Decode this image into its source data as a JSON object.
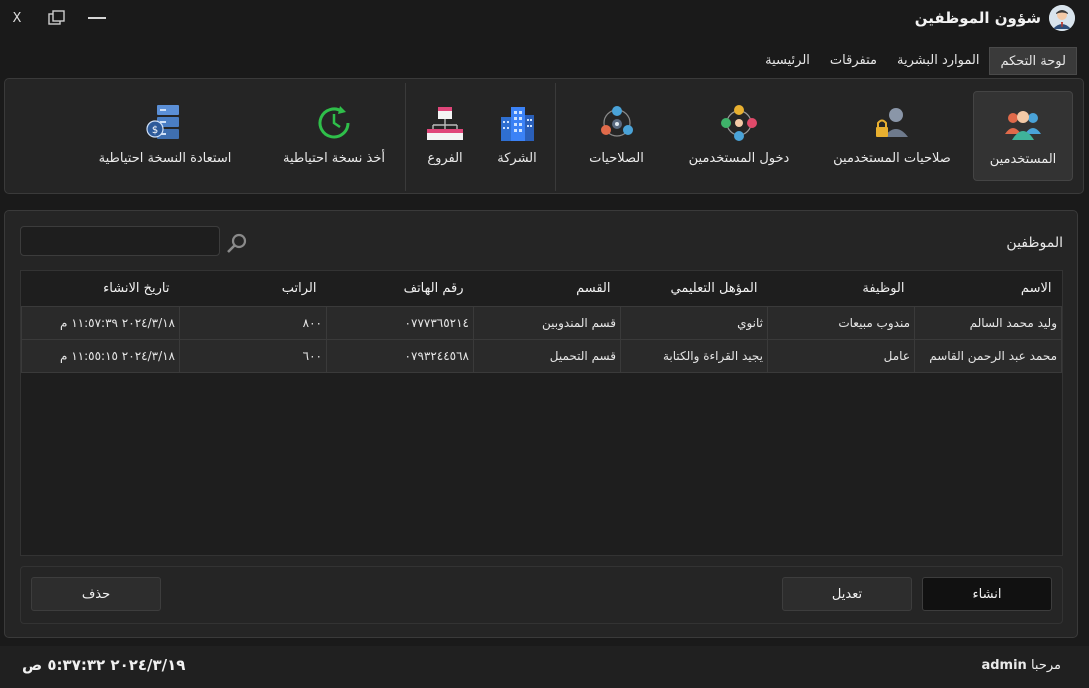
{
  "window": {
    "title": "شؤون الموظفين",
    "close_label": "X"
  },
  "menu": {
    "items": [
      {
        "label": "الرئيسية",
        "active": false
      },
      {
        "label": "متفرقات",
        "active": false
      },
      {
        "label": "الموارد البشرية",
        "active": false
      },
      {
        "label": "لوحة التحكم",
        "active": true
      }
    ]
  },
  "ribbon": {
    "users": "المستخدمين",
    "user_permissions": "صلاحيات المستخدمين",
    "user_login": "دخول المستخدمين",
    "permissions": "الصلاحيات",
    "company": "الشركة",
    "branches": "الفروع",
    "backup": "أخذ نسخة احتياطية",
    "restore": "استعادة النسخة احتياطية"
  },
  "section": {
    "title": "الموظفين",
    "search_value": ""
  },
  "table": {
    "columns": [
      "الاسم",
      "الوظيفة",
      "المؤهل التعليمي",
      "القسم",
      "رقم الهاتف",
      "الراتب",
      "تاريخ الانشاء"
    ],
    "rows": [
      [
        "وليد محمد السالم",
        "مندوب مبيعات",
        "ثانوي",
        "قسم المندوبين",
        "٠٧٧٧٣٦٥٢١٤",
        "٨٠٠",
        "٢٠٢٤/٣/١٨ ١١:٥٧:٣٩ م"
      ],
      [
        "محمد عبد الرحمن القاسم",
        "عامل",
        "يجيد القراءة والكتابة",
        "قسم التحميل",
        "٠٧٩٣٢٤٤٥٦٨",
        "٦٠٠",
        "٢٠٢٤/٣/١٨ ١١:٥٥:١٥ م"
      ]
    ]
  },
  "buttons": {
    "create": "انشاء",
    "edit": "تعديل",
    "delete": "حذف"
  },
  "status": {
    "welcome": "مرحبا",
    "user": "admin",
    "datetime": "٢٠٢٤/٣/١٩ ٥:٣٧:٣٢ ص"
  },
  "colors": {
    "background": "#1a1a1a",
    "panel": "#252525",
    "row": "#2a2a2a",
    "border": "#3a3a3a",
    "text": "#e8e8e8"
  }
}
